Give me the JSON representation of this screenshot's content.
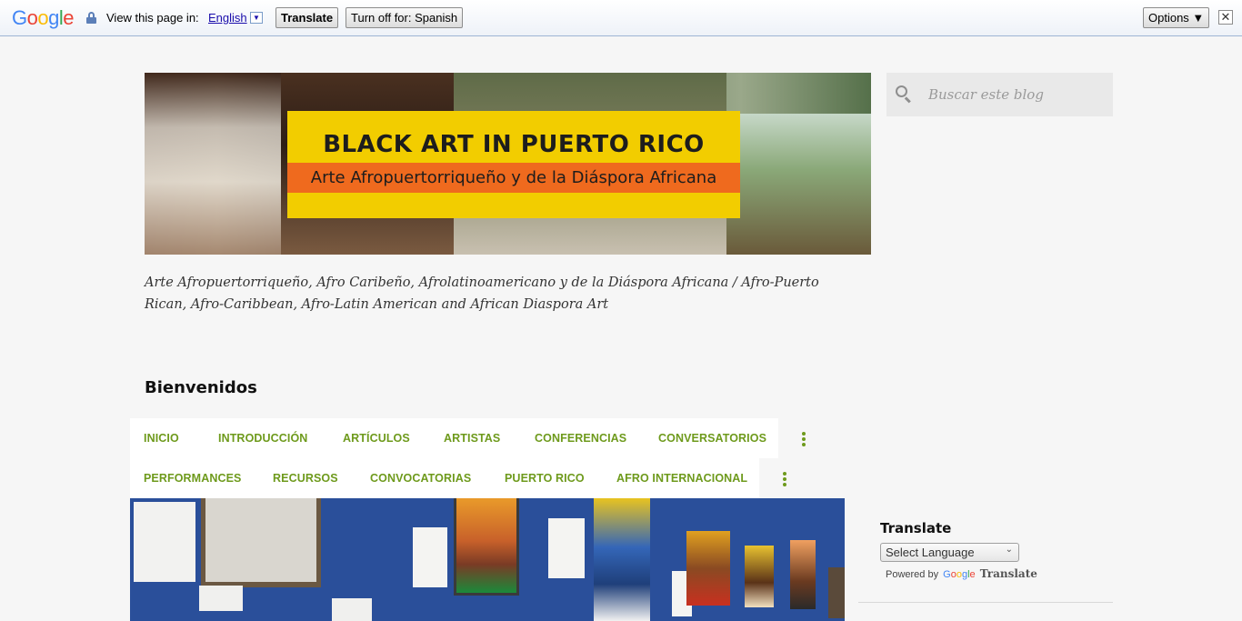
{
  "translate_bar": {
    "logo": [
      "G",
      "o",
      "o",
      "g",
      "l",
      "e"
    ],
    "view_text": "View this page in:",
    "language": "English",
    "language_arrow": "▼",
    "translate_label": "Translate",
    "turn_off_label": "Turn off for: Spanish",
    "options_label": "Options ▼",
    "close_label": "✕"
  },
  "banner": {
    "title": "BLACK ART IN PUERTO RICO",
    "subtitle": "Arte Afropuertorriqueño y de la Diáspora Africana"
  },
  "description": "Arte Afropuertorriqueño, Afro Caribeño, Afrolatinoamericano y de la Diáspora Africana / Afro-Puerto Rican, Afro-Caribbean, Afro-Latin American and African Diaspora Art",
  "search": {
    "placeholder": "Buscar este blog"
  },
  "welcome": "Bienvenidos",
  "nav": {
    "row1": [
      "INICIO",
      "INTRODUCCIÓN",
      "ARTÍCULOS",
      "ARTISTAS",
      "CONFERENCIAS",
      "CONVERSATORIOS"
    ],
    "row2": [
      "PERFORMANCES",
      "RECURSOS",
      "CONVOCATORIAS",
      "PUERTO RICO",
      "AFRO INTERNACIONAL"
    ]
  },
  "translate_widget": {
    "title": "Translate",
    "select_value": "Select Language",
    "powered_by": "Powered by",
    "google": "Google",
    "translate_word": "Translate"
  },
  "colors": {
    "nav_link": "#6e9a1c",
    "banner_yellow": "#f2cd00",
    "banner_orange": "#ef6a1e"
  }
}
